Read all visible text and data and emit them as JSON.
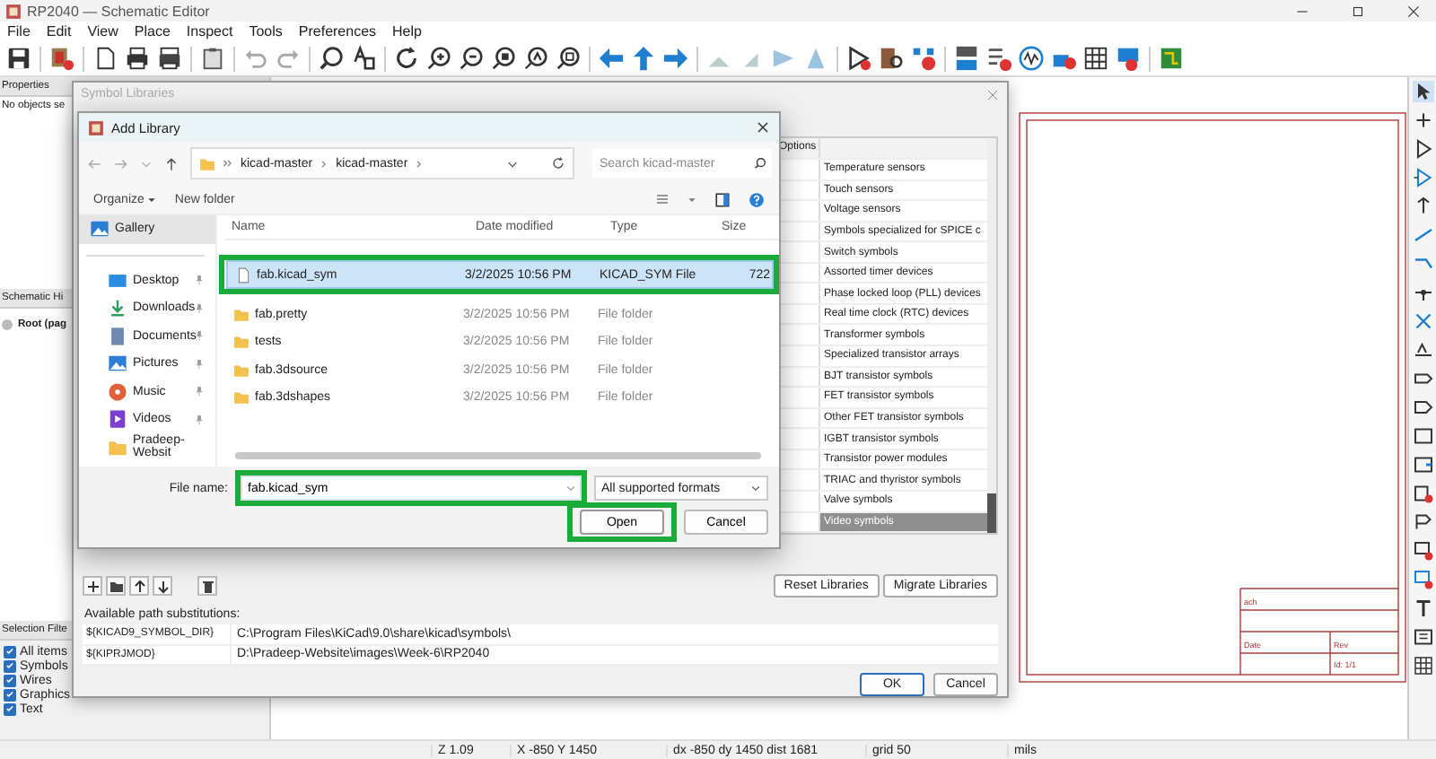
{
  "window": {
    "title": "RP2040 — Schematic Editor"
  },
  "menu": [
    "File",
    "Edit",
    "View",
    "Place",
    "Inspect",
    "Tools",
    "Preferences",
    "Help"
  ],
  "properties_panel": {
    "title": "Properties",
    "message": "No objects se"
  },
  "hierarchy_panel": {
    "title": "Schematic Hi",
    "items": [
      {
        "label": "Root (pag",
        "selected": false
      }
    ]
  },
  "selection_filter": {
    "title": "Selection Filte",
    "items": [
      {
        "label": "All items",
        "checked": true
      },
      {
        "label": "Symbols",
        "checked": true
      },
      {
        "label": "Wires",
        "checked": true
      },
      {
        "label": "Graphics",
        "checked": true
      },
      {
        "label": "Text",
        "checked": true
      }
    ]
  },
  "schematic": {
    "title_block": [
      "ach",
      "Date",
      "Rev",
      "Id: 1/1"
    ]
  },
  "status_bar": [
    "Z 1.09",
    "X -850  Y 1450",
    "dx -850  dy 1450  dist 1681",
    "grid 50",
    "mils"
  ],
  "symbol_libraries": {
    "title": "Symbol Libraries",
    "columns": [
      "Options"
    ],
    "rows": [
      {
        "description": "Temperature sensors",
        "selected": false
      },
      {
        "description": "Touch sensors",
        "selected": false
      },
      {
        "description": "Voltage sensors",
        "selected": false
      },
      {
        "description": "Symbols specialized for SPICE c",
        "selected": false
      },
      {
        "description": "Switch symbols",
        "selected": false
      },
      {
        "description": "Assorted timer devices",
        "selected": false
      },
      {
        "description": "Phase locked loop (PLL) devices",
        "selected": false
      },
      {
        "description": "Real time clock (RTC) devices",
        "selected": false
      },
      {
        "description": "Transformer symbols",
        "selected": false
      },
      {
        "description": "Specialized transistor arrays",
        "selected": false
      },
      {
        "description": "BJT transistor symbols",
        "selected": false
      },
      {
        "description": "FET transistor symbols",
        "selected": false
      },
      {
        "description": "Other FET transistor symbols",
        "selected": false
      },
      {
        "description": "IGBT transistor symbols",
        "selected": false
      },
      {
        "description": "Transistor power modules",
        "selected": false
      },
      {
        "description": "TRIAC and thyristor symbols",
        "selected": false
      },
      {
        "description": "Valve symbols",
        "selected": false
      },
      {
        "description": "Video symbols",
        "selected": true
      }
    ],
    "buttons": [
      "Reset Libraries",
      "Migrate Libraries"
    ],
    "path_label": "Available path substitutions:",
    "paths": [
      {
        "name": "${KICAD9_SYMBOL_DIR}",
        "value": "C:\\Program Files\\KiCad\\9.0\\share\\kicad\\symbols\\"
      },
      {
        "name": "${KIPRJMOD}",
        "value": "D:\\Pradeep-Website\\images\\Week-6\\RP2040"
      }
    ],
    "footer_buttons": [
      {
        "label": "OK",
        "default": true
      },
      {
        "label": "Cancel",
        "default": false
      }
    ]
  },
  "add_library": {
    "title": "Add Library",
    "breadcrumb": [
      "kicad-master",
      "kicad-master"
    ],
    "search": {
      "placeholder": "Search kicad-master"
    },
    "commands": [
      "Organize",
      "New folder"
    ],
    "nav": [
      {
        "label": "Gallery",
        "kind": "gallery",
        "selected": true,
        "pinned": false
      },
      {
        "label": "Desktop",
        "kind": "desktop",
        "selected": false,
        "pinned": true
      },
      {
        "label": "Downloads",
        "kind": "downloads",
        "selected": false,
        "pinned": true
      },
      {
        "label": "Documents",
        "kind": "documents",
        "selected": false,
        "pinned": true
      },
      {
        "label": "Pictures",
        "kind": "pictures",
        "selected": false,
        "pinned": true
      },
      {
        "label": "Music",
        "kind": "music",
        "selected": false,
        "pinned": true
      },
      {
        "label": "Videos",
        "kind": "videos",
        "selected": false,
        "pinned": true
      },
      {
        "label": "Pradeep-Websit",
        "kind": "folder",
        "selected": false,
        "pinned": false
      }
    ],
    "columns": [
      "Name",
      "Date modified",
      "Type",
      "Size"
    ],
    "files": [
      {
        "name": "fab.kicad_sym",
        "kind": "file",
        "date": "3/2/2025 10:56 PM",
        "type": "KICAD_SYM File",
        "size": "722",
        "selected": true,
        "highlighted": true
      },
      {
        "name": "fab.pretty",
        "kind": "folder",
        "date": "3/2/2025 10:56 PM",
        "type": "File folder",
        "selected": false,
        "highlighted": false
      },
      {
        "name": "tests",
        "kind": "folder",
        "date": "3/2/2025 10:56 PM",
        "type": "File folder",
        "selected": false,
        "highlighted": false
      },
      {
        "name": "fab.3dsource",
        "kind": "folder",
        "date": "3/2/2025 10:56 PM",
        "type": "File folder",
        "selected": false,
        "highlighted": false
      },
      {
        "name": "fab.3dshapes",
        "kind": "folder",
        "date": "3/2/2025 10:56 PM",
        "type": "File folder",
        "selected": false,
        "highlighted": false
      }
    ],
    "file_name_label": "File name:",
    "file_name": {
      "value": "fab.kicad_sym",
      "highlighted": true
    },
    "filter": "All supported formats",
    "buttons": [
      {
        "label": "Open",
        "highlighted": true
      },
      {
        "label": "Cancel",
        "highlighted": false
      }
    ]
  }
}
